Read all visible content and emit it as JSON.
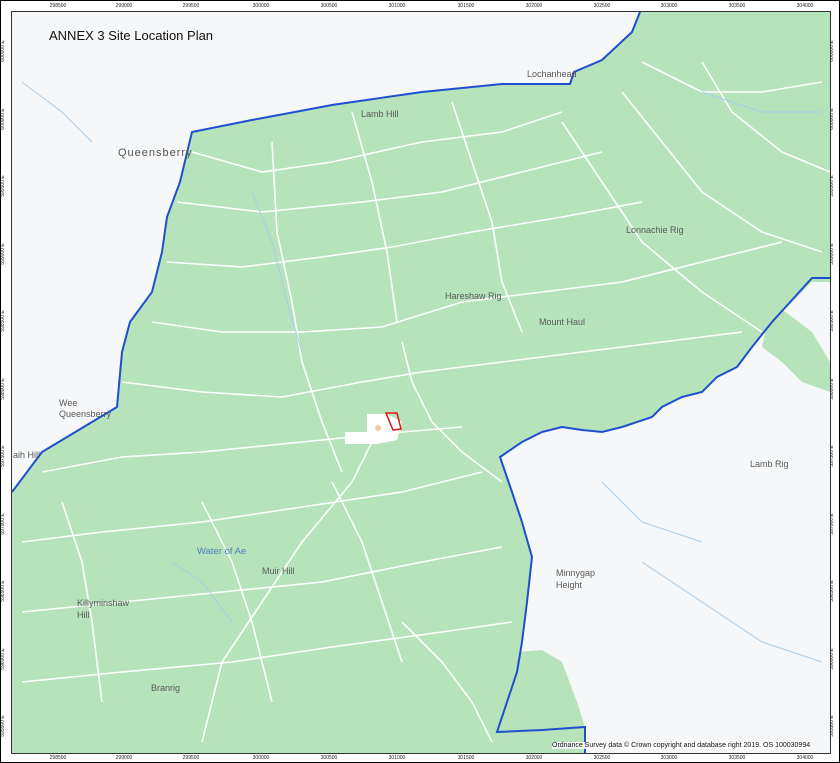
{
  "title": "ANNEX 3 Site Location Plan",
  "copyright": "Ordnance Survey data © Crown copyright and database right 2019. OS 100030994",
  "colors": {
    "forest": "#b6e3ba",
    "open_land": "#f6f7f8",
    "boundary": "#1f4fd1",
    "site": "#e0141e",
    "tracks": "#ffffff",
    "water": "#a9cde9"
  },
  "ticks": {
    "top": [
      "298500",
      "299000",
      "299500",
      "300000",
      "300500",
      "301000",
      "301500",
      "302000",
      "302500",
      "303000",
      "303500",
      "304000"
    ],
    "bottom": [
      "298500",
      "299000",
      "299500",
      "300000",
      "300500",
      "301000",
      "301500",
      "302000",
      "302500",
      "303000",
      "303500",
      "304000"
    ],
    "left": [
      "600000 E",
      "600000 E",
      "599500 E",
      "599000 E",
      "598500 E",
      "598000 E",
      "597500 E",
      "597000 E",
      "596500 E",
      "596000 E",
      "595500 E"
    ],
    "right": [
      "600000 E",
      "600000 E",
      "599500 E",
      "599000 E",
      "598500 E",
      "598000 E",
      "597500 E",
      "597000 E",
      "596500 E",
      "596000 E",
      "595500 E"
    ]
  },
  "places": {
    "lochanhead": "Lochanhead",
    "lamb_hill": "Lamb Hill",
    "queensberry": "Queensberry",
    "lonnachie_rig": "Lonnachie Rig",
    "hareshaw_rig": "Hareshaw Rig",
    "mount_haul": "Mount Haul",
    "wee_queensberry_1": "Wee",
    "wee_queensberry_2": "Queensberry",
    "craigh_hill": "aih Hill",
    "lamb_rig": "Lamb Rig",
    "water_of_ae": "Water of Ae",
    "muir_hill": "Muir Hill",
    "minnygap_1": "Minnygap",
    "minnygap_2": "Height",
    "killyminshaw_1": "Killyminshaw",
    "killyminshaw_2": "Hill",
    "branrig": "Branrig"
  }
}
